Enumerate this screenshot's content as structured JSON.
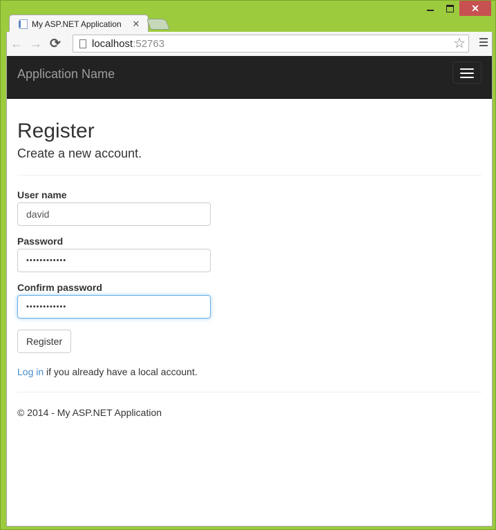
{
  "window": {
    "controls": {
      "minimize": "minimize",
      "maximize": "maximize",
      "close": "✕"
    }
  },
  "browser": {
    "tab": {
      "title": "My ASP.NET Application",
      "close": "✕",
      "icon": "page-icon"
    },
    "nav": {
      "back": "←",
      "forward": "→",
      "reload": "C"
    },
    "url": {
      "host": "localhost",
      "port": ":52763"
    },
    "bookmark_icon": "☆"
  },
  "navbar": {
    "brand": "Application Name",
    "toggle_icon": "hamburger-icon"
  },
  "page": {
    "title": "Register",
    "subtitle": "Create a new account.",
    "form": {
      "username": {
        "label": "User name",
        "value": "david"
      },
      "password": {
        "label": "Password",
        "value": "••••••••••••"
      },
      "confirm": {
        "label": "Confirm password",
        "value": "••••••••••••"
      },
      "submit": "Register"
    },
    "login_link": "Log in",
    "login_text": " if you already have a local account."
  },
  "footer": {
    "text": "© 2014 - My ASP.NET Application"
  }
}
